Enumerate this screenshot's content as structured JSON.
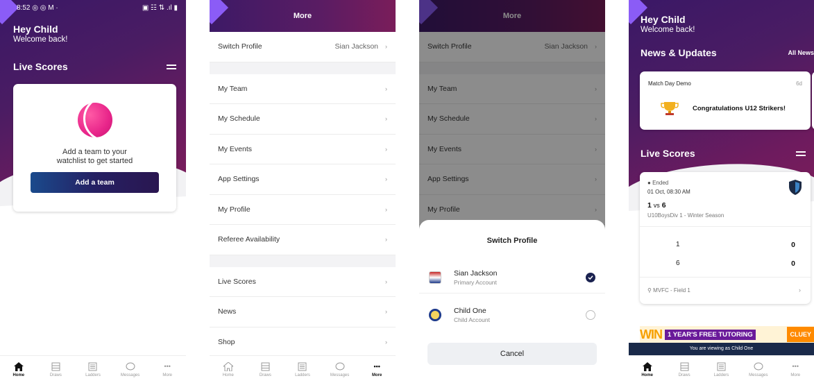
{
  "phone1": {
    "status_time": "8:52",
    "status_left_icons": "◎ ◎ M ·",
    "status_right_icons": "▣ ☷ ⇅ .ıl ▮",
    "greeting": "Hey Child",
    "welcome": "Welcome back!",
    "live_scores": "Live Scores",
    "empty_message_line1": "Add a team to your",
    "empty_message_line2": "watchlist to get started",
    "add_team_button": "Add a team",
    "accent": "#e8258a"
  },
  "tabs": [
    {
      "label": "Home",
      "icon": "home-icon"
    },
    {
      "label": "Draws",
      "icon": "draws-icon"
    },
    {
      "label": "Ladders",
      "icon": "ladders-icon"
    },
    {
      "label": "Messages",
      "icon": "messages-icon"
    },
    {
      "label": "More",
      "icon": "more-icon"
    }
  ],
  "more": {
    "title": "More",
    "switch_profile": {
      "label": "Switch Profile",
      "value": "Sian Jackson"
    },
    "group1": [
      "My Team",
      "My Schedule",
      "My Events",
      "App Settings",
      "My Profile",
      "Referee Availability"
    ],
    "group2": [
      "Live Scores",
      "News",
      "Shop"
    ]
  },
  "sheet": {
    "title": "Switch Profile",
    "accounts": [
      {
        "name": "Sian Jackson",
        "type": "Primary Account",
        "selected": true
      },
      {
        "name": "Child One",
        "type": "Child Account",
        "selected": false
      }
    ],
    "cancel": "Cancel"
  },
  "phone4": {
    "greeting": "Hey Child",
    "welcome": "Welcome back!",
    "news_title": "News & Updates",
    "all_news": "All News",
    "news_item": {
      "source": "Match Day Demo",
      "age": "6d",
      "headline": "Congratulations U12 Strikers!"
    },
    "live_scores": "Live Scores",
    "match": {
      "status": "Ended",
      "datetime": "01 Oct, 08:30 AM",
      "teams": "1 vs 6",
      "team_a": "1",
      "vs": "vs",
      "team_b": "6",
      "division": "U10BoysDiv 1 - Winter Season",
      "rows": [
        {
          "team": "1",
          "score": "0"
        },
        {
          "team": "6",
          "score": "0"
        }
      ],
      "venue": "MVFC - Field 1"
    },
    "banner": {
      "win": "WIN",
      "text": "1 YEAR'S FREE TUTORING",
      "brand": "CLUEY"
    },
    "viewing_as": "You are viewing as Child One"
  }
}
